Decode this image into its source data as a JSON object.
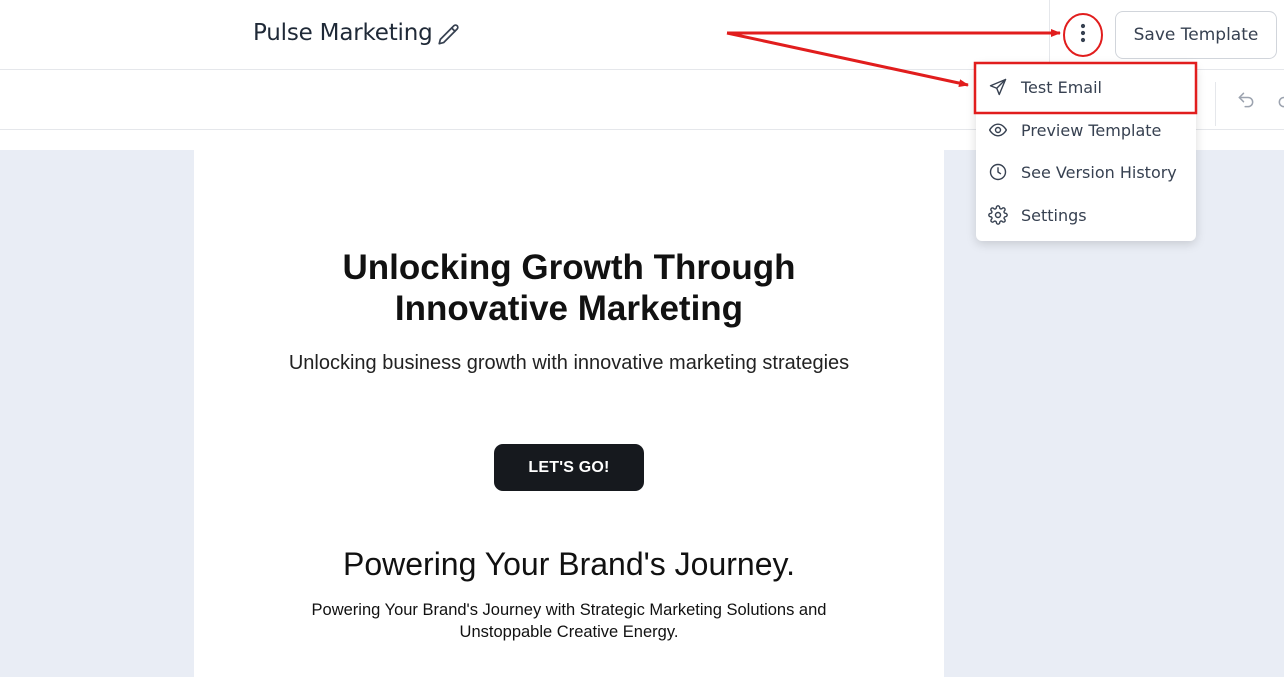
{
  "header": {
    "template_name": "Pulse Marketing",
    "save_label": "Save Template"
  },
  "menu": {
    "items": [
      {
        "label": "Test Email",
        "icon": "send-icon"
      },
      {
        "label": "Preview Template",
        "icon": "eye-icon"
      },
      {
        "label": "See Version History",
        "icon": "history-icon"
      },
      {
        "label": "Settings",
        "icon": "gear-icon"
      }
    ]
  },
  "email": {
    "hero_title": "Unlocking Growth Through Innovative Marketing",
    "hero_subtitle": "Unlocking business growth with innovative marketing strategies",
    "cta_label": "LET'S GO!",
    "section_title": "Powering Your Brand's Journey.",
    "section_body": "Powering Your Brand's Journey with Strategic Marketing Solutions and Unstoppable Creative Energy."
  },
  "colors": {
    "annotation": "#e11d1d",
    "canvas_bg": "#e9edf5",
    "cta_bg": "#16191e"
  }
}
